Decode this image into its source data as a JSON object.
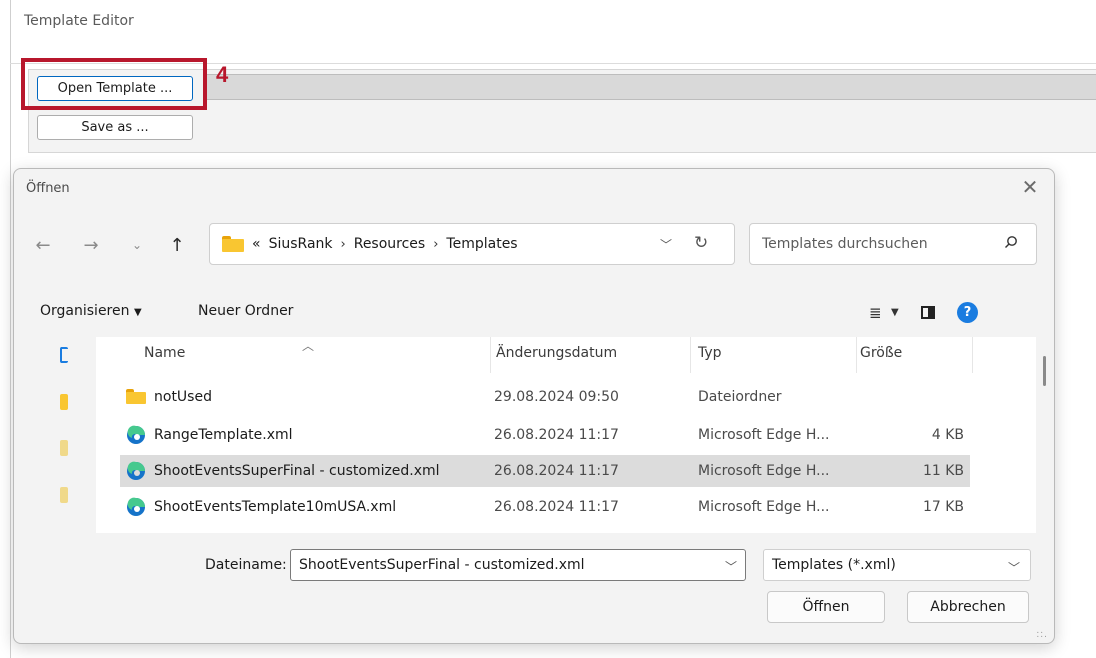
{
  "app": {
    "title": "Template Editor",
    "open_template_label": "Open Template ...",
    "save_as_label": "Save as ...",
    "highlight_number": "4",
    "highlight_color": "#b8172c"
  },
  "dialog": {
    "title": "Öffnen",
    "breadcrumb": {
      "prefix": "«",
      "items": [
        "SiusRank",
        "Resources",
        "Templates"
      ],
      "separator": "›"
    },
    "search_placeholder": "Templates durchsuchen",
    "commands": {
      "organize_label": "Organisieren",
      "new_folder_label": "Neuer Ordner"
    },
    "columns": {
      "name": "Name",
      "date": "Änderungsdatum",
      "type": "Typ",
      "size": "Größe"
    },
    "files": [
      {
        "name": "notUsed",
        "date": "29.08.2024 09:50",
        "type": "Dateiordner",
        "size": "",
        "icon": "folder-icon",
        "selected": false
      },
      {
        "name": "RangeTemplate.xml",
        "date": "26.08.2024 11:17",
        "type": "Microsoft Edge H...",
        "size": "4 KB",
        "icon": "edge-icon",
        "selected": false
      },
      {
        "name": "ShootEventsSuperFinal - customized.xml",
        "date": "26.08.2024 11:17",
        "type": "Microsoft Edge H...",
        "size": "11 KB",
        "icon": "edge-icon",
        "selected": true
      },
      {
        "name": "ShootEventsTemplate10mUSA.xml",
        "date": "26.08.2024 11:17",
        "type": "Microsoft Edge H...",
        "size": "17 KB",
        "icon": "edge-icon",
        "selected": false
      }
    ],
    "filename_label": "Dateiname:",
    "filename_value": "ShootEventsSuperFinal - customized.xml",
    "filetype_value": "Templates (*.xml)",
    "open_label": "Öffnen",
    "cancel_label": "Abbrechen"
  }
}
